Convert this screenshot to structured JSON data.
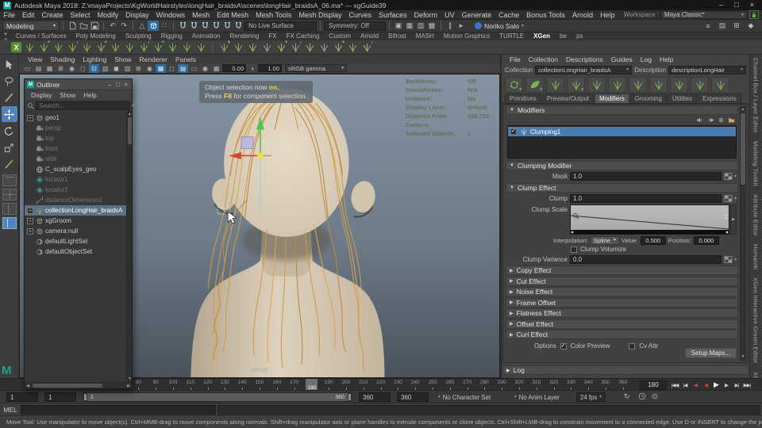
{
  "window": {
    "title": "Autodesk Maya 2018: Z:\\mayaProjects\\KgWorldHairstyles\\longHair_braidsA\\scenes\\longHair_braidsA_06.ma* --- xgGuide39"
  },
  "colors": {
    "xgen_green": "#7cb54b",
    "selection_blue": "#4a7cae",
    "tool_active_blue": "#5285b7",
    "outliner_selection": "#5a7184",
    "hair_orange": "#cf9a45",
    "toast_highlight": "#e9d94b"
  },
  "menu_bar": {
    "items": [
      "File",
      "Edit",
      "Create",
      "Select",
      "Modify",
      "Display",
      "Windows",
      "Mesh",
      "Edit Mesh",
      "Mesh Tools",
      "Mesh Display",
      "Curves",
      "Surfaces",
      "Deform",
      "UV",
      "Generate",
      "Cache",
      "Bonus Tools",
      "Arnold",
      "Help"
    ],
    "workspace_label": "Workspace :",
    "workspace_value": "Maya Classic*"
  },
  "status_line": {
    "menu_set": "Modeling",
    "live_surface": "No Live Surface",
    "symmetry": "Symmetry: Off",
    "user_name": "Noriko Salo"
  },
  "shelf": {
    "tabs": [
      "Curves / Surfaces",
      "Poly Modeling",
      "Sculpting",
      "Rigging",
      "Animation",
      "Rendering",
      "FX",
      "FX Caching",
      "Custom",
      "Arnold",
      "Bifrost",
      "MASH",
      "Motion Graphics",
      "TURTLE",
      "XGen",
      "be",
      "ps"
    ],
    "active_tab": "XGen"
  },
  "viewport": {
    "menus": [
      "View",
      "Shading",
      "Lighting",
      "Show",
      "Renderer",
      "Panels"
    ],
    "exposure": "0.00",
    "gamma": "1.00",
    "color_transform": "sRGB gamma",
    "camera_label": "persp",
    "hud": [
      {
        "label": "Backfaces:",
        "value": "Off"
      },
      {
        "label": "Smoothness:",
        "value": "N/A"
      },
      {
        "label": "Instance:",
        "value": "No"
      },
      {
        "label": "Display Layer:",
        "value": "default"
      },
      {
        "label": "Distance From Camera:",
        "value": "106.723"
      },
      {
        "label": "Selected Objects:",
        "value": "1"
      }
    ],
    "toast": {
      "line1_prefix": "Object selection now ",
      "line1_highlight": "on.",
      "line2_prefix": "Press ",
      "line2_highlight": "F8",
      "line2_suffix": " for component selection."
    }
  },
  "outliner": {
    "title": "Outliner",
    "menus": [
      "Display",
      "Show",
      "Help"
    ],
    "search_placeholder": "Search...",
    "items": [
      {
        "label": "geo1",
        "icon": "cube-icon",
        "expandable": true,
        "dim": false,
        "selected": false
      },
      {
        "label": "persp",
        "icon": "camera-icon",
        "dim": true
      },
      {
        "label": "top",
        "icon": "camera-icon",
        "dim": true
      },
      {
        "label": "front",
        "icon": "camera-icon",
        "dim": true
      },
      {
        "label": "side",
        "icon": "camera-icon",
        "dim": true
      },
      {
        "label": "C_scalpEyes_geo",
        "icon": "mesh-icon",
        "dim": false
      },
      {
        "label": "locator1",
        "icon": "locator-icon",
        "dim": true
      },
      {
        "label": "locator2",
        "icon": "locator-icon",
        "dim": true
      },
      {
        "label": "distanceDimension1",
        "icon": "distance-icon",
        "dim": true
      },
      {
        "label": "collectionLongHair_braidsA",
        "icon": "xgen-collection-icon",
        "expandable": true,
        "selected": true
      },
      {
        "label": "xgGroom",
        "icon": "cube-icon",
        "expandable": true
      },
      {
        "label": "camera:null",
        "icon": "cube-icon",
        "expandable": true
      },
      {
        "label": "defaultLightSet",
        "icon": "set-icon"
      },
      {
        "label": "defaultObjectSet",
        "icon": "set-icon"
      }
    ]
  },
  "xgen": {
    "menus": [
      "File",
      "Collection",
      "Descriptions",
      "Guides",
      "Log",
      "Help"
    ],
    "collection_label": "Collection",
    "collection_value": "collectionLongHair_braidsA",
    "description_label": "Description",
    "description_value": "descriptionLongHair",
    "tabs": [
      "Primitives",
      "Preview/Output",
      "Modifiers",
      "Grooming",
      "Utilities",
      "Expressions"
    ],
    "active_tab": "Modifiers",
    "modifiers_header": "Modifiers",
    "modifier_list": [
      {
        "name": "Clumping1",
        "checked": true,
        "selected": true
      }
    ],
    "clumping_modifier_header": "Clumping Modifier",
    "mask_label": "Mask",
    "mask_value": "1.0",
    "clump_effect_header": "Clump Effect",
    "clump_label": "Clump",
    "clump_value": "1.0",
    "clump_scale_label": "Clump Scale",
    "ramp_end_label": "1",
    "interpolation_label": "Interpolation:",
    "interpolation_value": "Spline",
    "value_label": "Value:",
    "value_field": "0.500",
    "position_label": "Position:",
    "position_field": "0.000",
    "volumize_label": "Clump Volumize",
    "volumize_checked": false,
    "variance_label": "Clump Variance",
    "variance_value": "0.0",
    "collapsed_sections": [
      "Copy Effect",
      "Cut Effect",
      "Noise Effect",
      "Frame Offset",
      "Flatness Effect",
      "Offset Effect",
      "Curl Effect"
    ],
    "options_label": "Options",
    "color_preview_label": "Color Preview",
    "color_preview_checked": true,
    "cv_attr_label": "Cv Attr",
    "cv_attr_checked": false,
    "setup_maps_label": "Setup Maps...",
    "log_label": "Log"
  },
  "right_tabs": [
    "Channel Box / Layer Editor",
    "Modeling Toolkit",
    "Attribute Editor",
    "HumanIK",
    "XGen Interactive Groom Editor",
    "XGen"
  ],
  "timeline": {
    "tick_start": 80,
    "tick_end": 360,
    "tick_step": 10,
    "current_frame": 180,
    "frame_field": "180"
  },
  "range_slider": {
    "anim_start": "1",
    "playback_start": "1",
    "range_start_label": "1",
    "range_end_label": "360",
    "playback_end": "360",
    "anim_end": "360",
    "character_set": "No Character Set",
    "anim_layer": "No Anim Layer",
    "fps": "24 fps"
  },
  "command_line": {
    "label": "MEL"
  },
  "help_line": {
    "text": "Move Tool: Use manipulator to move object(s). Ctrl+MMB-drag to move components along normals. Shift+drag manipulator axis or plane handles to extrude components or clone objects. Ctrl+Shift+LMB-drag to constrain movement to a connected edge. Use D or INSERT to change the pivot position and axis orientation."
  }
}
